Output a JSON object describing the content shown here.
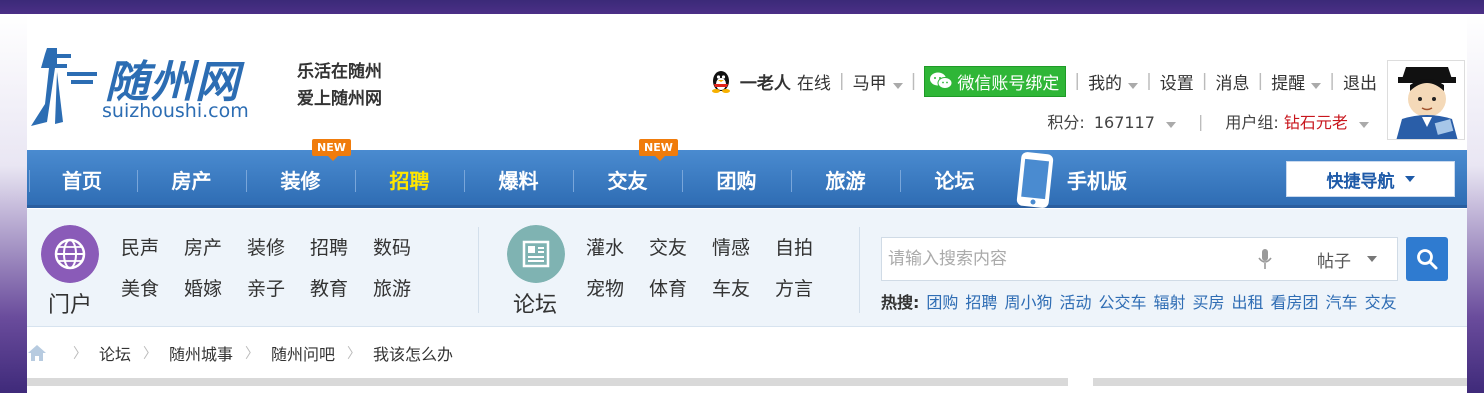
{
  "header": {
    "logo_name": "随州网",
    "logo_domain": "suizhoushi.com",
    "slogan_line1": "乐活在随州",
    "slogan_line2": "爱上随州网"
  },
  "user": {
    "username": "一老人",
    "online": "在线",
    "alt_name": "马甲",
    "wechat_bind": "微信账号绑定",
    "mine": "我的",
    "settings": "设置",
    "messages": "消息",
    "reminders": "提醒",
    "logout": "退出",
    "credits_label": "积分:",
    "credits_value": "167117",
    "group_label": "用户组:",
    "group_value": "钻石元老"
  },
  "nav": {
    "items": [
      {
        "label": "首页"
      },
      {
        "label": "房产"
      },
      {
        "label": "装修",
        "badge": "NEW"
      },
      {
        "label": "招聘"
      },
      {
        "label": "爆料"
      },
      {
        "label": "交友",
        "badge": "NEW"
      },
      {
        "label": "团购"
      },
      {
        "label": "旅游"
      },
      {
        "label": "论坛"
      },
      {
        "label": "手机版"
      }
    ],
    "quick_nav": "快捷导航"
  },
  "subnav": {
    "portal": {
      "label": "门户",
      "row1": [
        "民声",
        "房产",
        "装修",
        "招聘",
        "数码"
      ],
      "row2": [
        "美食",
        "婚嫁",
        "亲子",
        "教育",
        "旅游"
      ]
    },
    "forum": {
      "label": "论坛",
      "row1": [
        "灌水",
        "交友",
        "情感",
        "自拍"
      ],
      "row2": [
        "宠物",
        "体育",
        "车友",
        "方言"
      ]
    },
    "search": {
      "placeholder": "请输入搜索内容",
      "type": "帖子"
    },
    "hot": {
      "label": "热搜:",
      "items": [
        "团购",
        "招聘",
        "周小狗",
        "活动",
        "公交车",
        "辐射",
        "买房",
        "出租",
        "看房团",
        "汽车",
        "交友"
      ]
    }
  },
  "breadcrumb": [
    "论坛",
    "随州城事",
    "随州问吧",
    "我该怎么办"
  ],
  "colors": {
    "nav_blue": "#2f6db4",
    "highlight_yellow": "#ffe600",
    "badge_orange": "#f07c0c",
    "wechat_green": "#2fb637",
    "group_red": "#c8161d",
    "bg_purple": "#4b2f86"
  }
}
